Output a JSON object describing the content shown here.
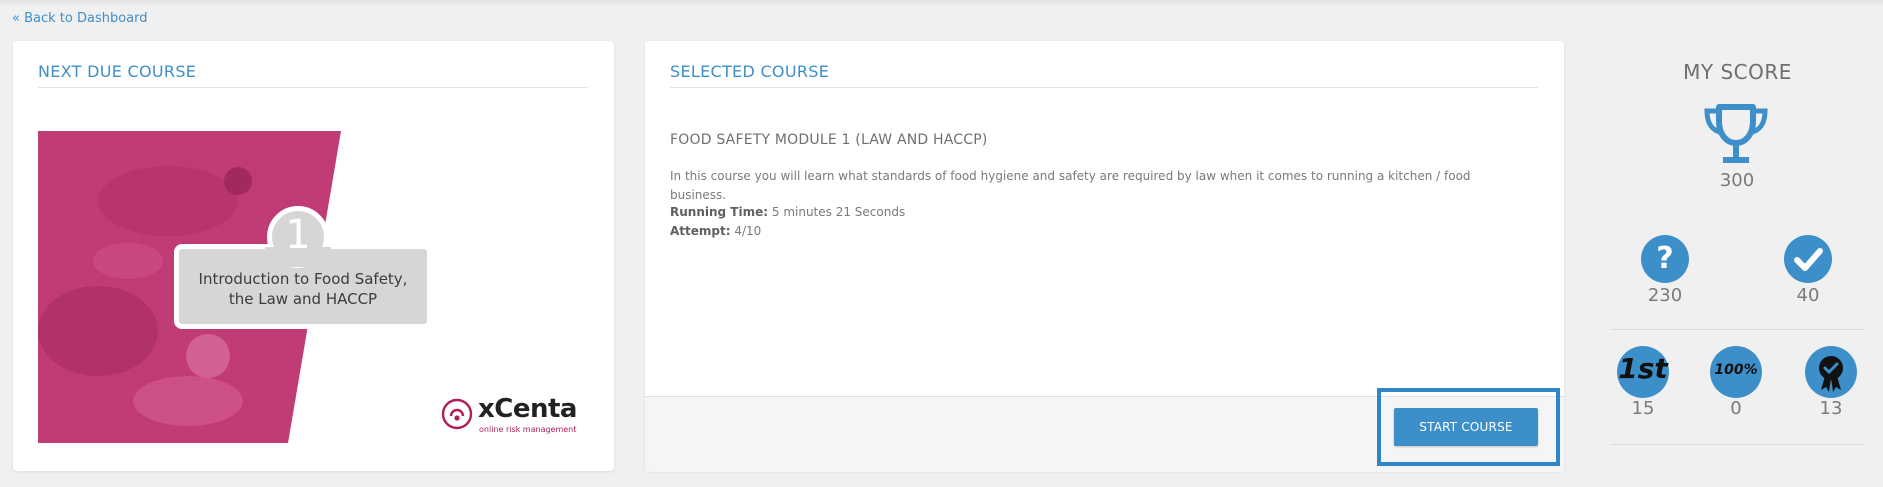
{
  "nav": {
    "back_label": "« Back to Dashboard"
  },
  "next_due": {
    "title": "NEXT DUE COURSE",
    "badge_number": "1",
    "image_caption_line1": "Introduction to Food Safety,",
    "image_caption_line2": "the Law and HACCP",
    "logo_text": "xCenta",
    "logo_tagline": "online risk management"
  },
  "selected": {
    "title": "SELECTED COURSE",
    "course_name": "FOOD SAFETY MODULE 1 (LAW AND HACCP)",
    "description": "In this course you will learn what standards of food hygiene and safety are required by law when it comes to running a kitchen / food business.",
    "running_time_label": "Running Time:",
    "running_time_value": "5 minutes 21 Seconds",
    "attempt_label": "Attempt:",
    "attempt_value": "4/10",
    "start_button": "START COURSE"
  },
  "score": {
    "title": "MY SCORE",
    "total": "300",
    "questions": "230",
    "correct": "40",
    "first_place": "15",
    "perfect": "0",
    "awards": "13",
    "first_badge_text": "1st",
    "perfect_badge_text": "100%"
  },
  "colors": {
    "accent": "#3d8fc9",
    "magenta": "#c03a73",
    "logo": "#b21e5c"
  }
}
